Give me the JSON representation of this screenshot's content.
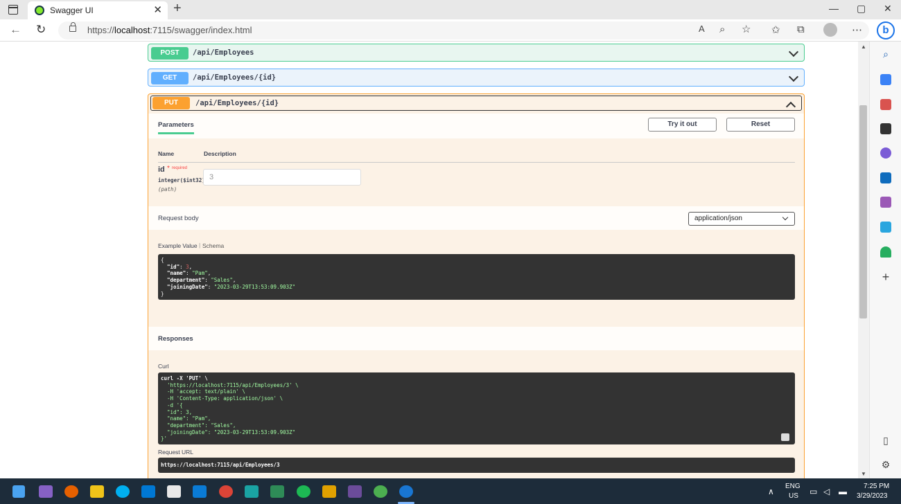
{
  "browser": {
    "tab_title": "Swagger UI",
    "url_prefix": "https://",
    "url_host": "localhost",
    "url_rest": ":7115/swagger/index.html"
  },
  "operations": {
    "post": {
      "method": "POST",
      "path": "/api/Employees"
    },
    "get": {
      "method": "GET",
      "path": "/api/Employees/{id}"
    },
    "put": {
      "method": "PUT",
      "path": "/api/Employees/{id}"
    }
  },
  "put_panel": {
    "parameters_tab": "Parameters",
    "try_button": "Try it out",
    "reset_button": "Reset",
    "col_name": "Name",
    "col_description": "Description",
    "param": {
      "name": "id",
      "required_star": "*",
      "required_text": "required",
      "type": "integer($int32)",
      "location": "(path)",
      "value": "3"
    },
    "request_body_label": "Request body",
    "content_type": "application/json",
    "example_tab": "Example Value",
    "schema_tab": "Schema",
    "example": {
      "open": "{",
      "id_key": "\"id\"",
      "id_val": "3",
      "name_key": "\"name\"",
      "name_val": "\"Pam\"",
      "dept_key": "\"department\"",
      "dept_val": "\"Sales\"",
      "date_key": "\"joiningDate\"",
      "date_val": "\"2023-03-29T13:53:09.903Z\"",
      "close": "}"
    },
    "responses_label": "Responses",
    "curl_label": "Curl",
    "curl_lines": [
      "curl -X 'PUT' \\",
      "  'https://localhost:7115/api/Employees/3' \\",
      "  -H 'accept: text/plain' \\",
      "  -H 'Content-Type: application/json' \\",
      "  -d '{",
      "  \"id\": 3,",
      "  \"name\": \"Pam\",",
      "  \"department\": \"Sales\",",
      "  \"joiningDate\": \"2023-03-29T13:53:09.903Z\"",
      "}'"
    ],
    "request_url_label": "Request URL",
    "request_url": "https://localhost:7115/api/Employees/3"
  },
  "taskbar": {
    "lang_top": "ENG",
    "lang_bottom": "US",
    "time": "7:25 PM",
    "date": "3/29/2023"
  },
  "colors": {
    "post": "#49cc90",
    "get": "#61affe",
    "put": "#fca130"
  }
}
